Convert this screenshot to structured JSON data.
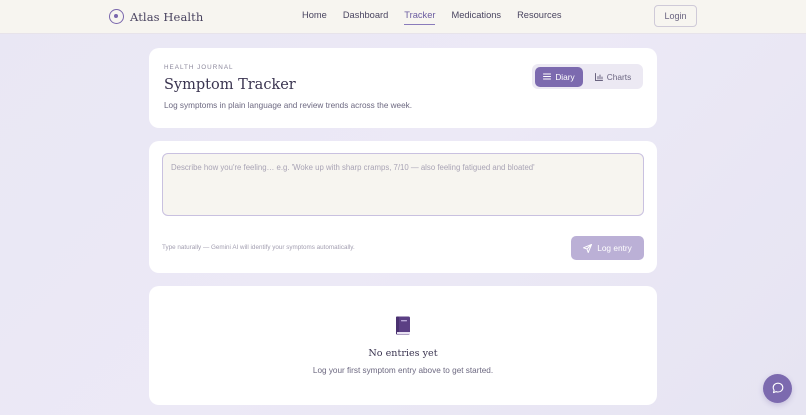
{
  "brand": {
    "name": "Atlas Health",
    "logo_icon": "atlas-logo-icon"
  },
  "nav": {
    "links": [
      {
        "label": "Home",
        "active": false
      },
      {
        "label": "Dashboard",
        "active": false
      },
      {
        "label": "Tracker",
        "active": true
      },
      {
        "label": "Medications",
        "active": false
      },
      {
        "label": "Resources",
        "active": false
      }
    ],
    "login_label": "Login"
  },
  "header": {
    "eyebrow": "HEALTH JOURNAL",
    "title": "Symptom Tracker",
    "subtitle": "Log symptoms in plain language and review trends across the week.",
    "toggle": {
      "diary_label": "Diary",
      "charts_label": "Charts",
      "selected": "Diary"
    }
  },
  "entry": {
    "value": "",
    "placeholder": "Describe how you're feeling… e.g. 'Woke up with sharp cramps, 7/10 — also feeling fatigued and bloated'",
    "hint": "Type naturally — Gemini AI will identify your symptoms automatically.",
    "submit_label": "Log entry"
  },
  "empty_state": {
    "icon": "book-icon",
    "title": "No entries yet",
    "subtitle": "Log your first symptom entry above to get started."
  },
  "chat_fab": {
    "icon": "chat-bubble-icon"
  },
  "colors": {
    "accent": "#7c6aaf",
    "accent_disabled": "#bbb0d6",
    "background": "#ebe9f5",
    "nav_bg": "#f7f5f0"
  }
}
